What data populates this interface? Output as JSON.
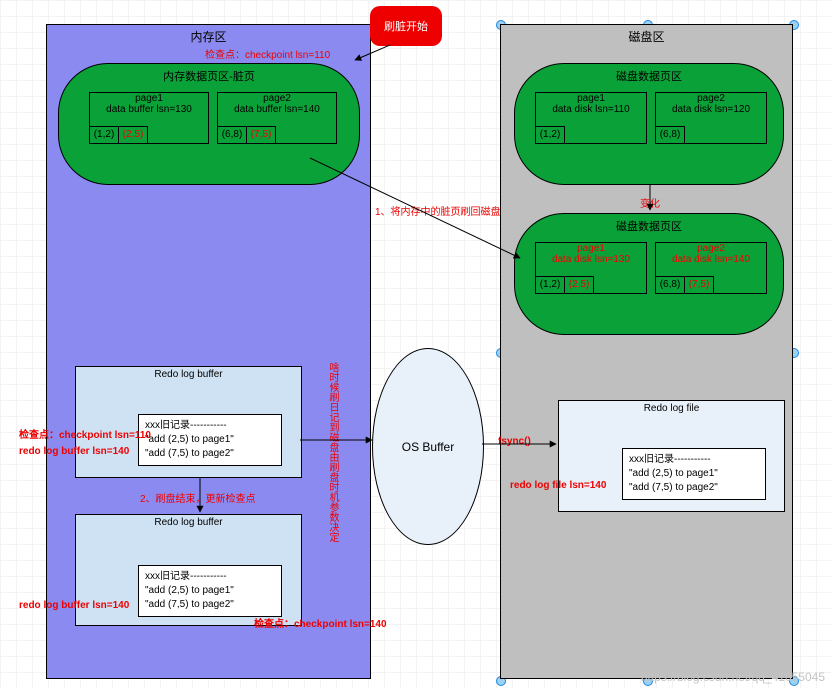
{
  "diagram": {
    "title_badge": "刷脏开始",
    "memory_region": {
      "title": "内存区",
      "data_block": {
        "title": "内存数据页区-脏页",
        "pages": [
          {
            "name": "page1",
            "lsn_label": "data buffer lsn=130",
            "cells": [
              "(1,2)",
              "(2,5)"
            ],
            "changed_index": 1
          },
          {
            "name": "page2",
            "lsn_label": "data buffer lsn=140",
            "cells": [
              "(6,8)",
              "(7,5)"
            ],
            "changed_index": 1
          }
        ]
      },
      "redo_log_buffer_1": {
        "title": "Redo log buffer",
        "records": [
          "xxx旧记录-----------",
          "\"add (2,5) to page1\"",
          "\"add (7,5) to page2\""
        ],
        "left_labels": [
          "检查点：checkpoint lsn=110",
          "redo log buffer lsn=140"
        ]
      },
      "step2_label": "2、刷盘结束，更新检查点",
      "redo_log_buffer_2": {
        "title": "Redo log buffer",
        "records": [
          "xxx旧记录-----------",
          "\"add (2,5) to page1\"",
          "\"add (7,5) to page2\""
        ],
        "left_label": "redo log buffer lsn=140",
        "right_label": "检查点：checkpoint lsn=140"
      },
      "checkpoint_top_label": "检查点：checkpoint lsn=110"
    },
    "disk_region": {
      "title": "磁盘区",
      "data_block_before": {
        "title": "磁盘数据页区",
        "pages": [
          {
            "name": "page1",
            "lsn_label": "data disk lsn=110",
            "cells": [
              "(1,2)"
            ]
          },
          {
            "name": "page2",
            "lsn_label": "data disk lsn=120",
            "cells": [
              "(6,8)"
            ]
          }
        ]
      },
      "change_label": "变化",
      "data_block_after": {
        "title": "磁盘数据页区",
        "pages": [
          {
            "name": "page1",
            "lsn_label": "data disk lsn=130",
            "cells": [
              "(1,2)",
              "(2,5)"
            ],
            "changed": true,
            "changed_index": 1
          },
          {
            "name": "page2",
            "lsn_label": "data disk lsn=140",
            "cells": [
              "(6,8)",
              "(7,5)"
            ],
            "changed": true,
            "changed_index": 1
          }
        ]
      },
      "redo_log_file": {
        "title": "Redo log file",
        "records": [
          "xxx旧记录-----------",
          "\"add (2,5) to page1\"",
          "\"add (7,5) to page2\""
        ],
        "left_label": "redo log file lsn=140"
      }
    },
    "os_buffer_label": "OS Buffer",
    "arrows": {
      "mem_to_disk": "1、将内存中的脏页刷回磁盘",
      "os_vertical": "啥时候刷日记到磁盘由刷盘时机参数决定",
      "fsync": "fsync()"
    },
    "watermark": "https://blog.csdn.net/qq_41055045"
  }
}
